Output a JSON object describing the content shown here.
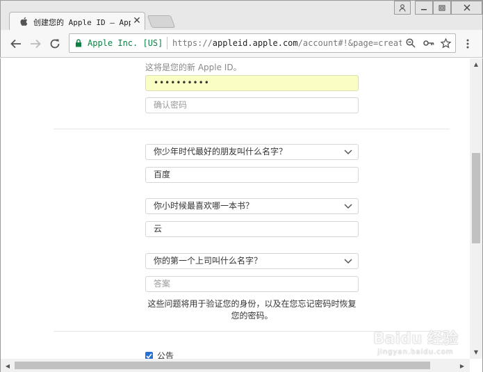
{
  "browser": {
    "tab": {
      "title": "创建您的 Apple  ID – Apple",
      "favicon": "apple-logo-icon"
    },
    "window_controls": [
      "user-icon",
      "minimize-icon",
      "restore-icon",
      "close-icon"
    ],
    "toolbar": {
      "secure_label": "Apple Inc. [US]",
      "url_scheme": "https://",
      "url_host": "appleid.apple.com",
      "url_rest": "/account#!&page=create"
    }
  },
  "form": {
    "apple_id_hint": "这将是您的新 Apple ID。",
    "password_value": "••••••••••",
    "confirm_password_placeholder": "确认密码",
    "security_questions": [
      {
        "question": "你少年时代最好的朋友叫什么名字？",
        "answer": "百度",
        "answer_placeholder": ""
      },
      {
        "question": "你小时候最喜欢哪一本书？",
        "answer": "云",
        "answer_placeholder": ""
      },
      {
        "question": "你的第一个上司叫什么名字？",
        "answer": "",
        "answer_placeholder": "答案"
      }
    ],
    "help_text": "这些问题将用于验证您的身份，以及在您忘记密码时恢复您的密码。",
    "announcement_checkbox": {
      "label": "公告",
      "checked": true
    }
  },
  "watermark": {
    "brand": "Baidu 经验",
    "sub": "jingyan.baidu.com"
  },
  "colors": {
    "secure_green": "#0b8043",
    "autofill_yellow": "#fafdc4",
    "checkbox_blue": "#2a6fd6"
  }
}
